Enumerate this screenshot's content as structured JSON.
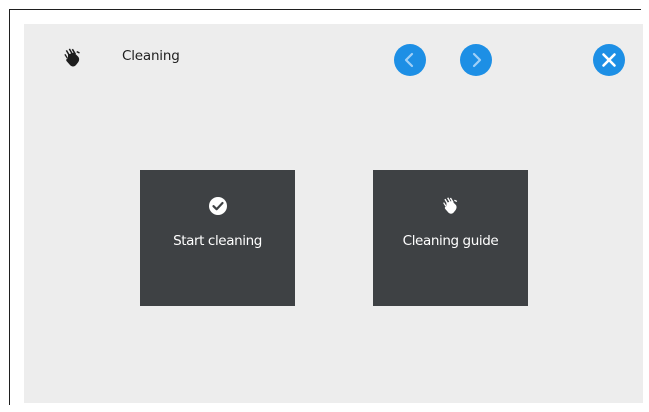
{
  "header": {
    "title": "Cleaning",
    "icon": "hand-icon",
    "prev_icon": "chevron-left-icon",
    "next_icon": "chevron-right-icon",
    "close_icon": "close-icon"
  },
  "tiles": [
    {
      "label": "Start cleaning",
      "icon": "checkmark-circle-icon"
    },
    {
      "label": "Cleaning guide",
      "icon": "hand-icon"
    }
  ],
  "colors": {
    "accent": "#1d8fe5",
    "tile_background": "#3e4144",
    "screen_background": "#ededed"
  }
}
